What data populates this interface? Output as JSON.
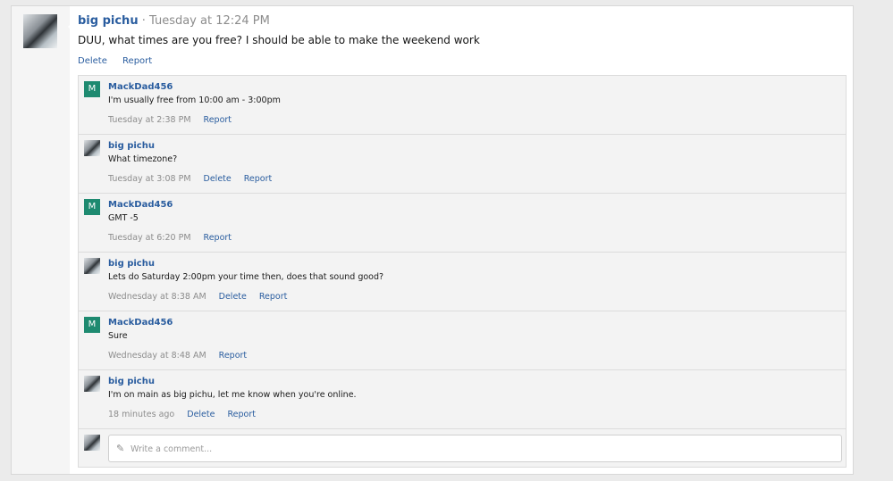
{
  "post": {
    "username": "big pichu",
    "separator": " · ",
    "timestamp": "Tuesday at 12:24 PM",
    "text": "DUU, what times are you free? I should be able to make the weekend work",
    "delete_label": "Delete",
    "report_label": "Report"
  },
  "replies": [
    {
      "avatar_letter": "M",
      "username": "MackDad456",
      "text": "I'm usually free from 10:00 am - 3:00pm",
      "time": "Tuesday at 2:38 PM",
      "report_label": "Report"
    },
    {
      "username": "big pichu",
      "text": "What timezone?",
      "time": "Tuesday at 3:08 PM",
      "delete_label": "Delete",
      "report_label": "Report"
    },
    {
      "avatar_letter": "M",
      "username": "MackDad456",
      "text": "GMT -5",
      "time": "Tuesday at 6:20 PM",
      "report_label": "Report"
    },
    {
      "username": "big pichu",
      "text": "Lets do Saturday 2:00pm your time then, does that sound good?",
      "time": "Wednesday at 8:38 AM",
      "delete_label": "Delete",
      "report_label": "Report"
    },
    {
      "avatar_letter": "M",
      "username": "MackDad456",
      "text": "Sure",
      "time": "Wednesday at 8:48 AM",
      "report_label": "Report"
    },
    {
      "username": "big pichu",
      "text": "I'm on main as big pichu, let me know when you're online.",
      "time": "18 minutes ago",
      "delete_label": "Delete",
      "report_label": "Report"
    }
  ],
  "comment": {
    "placeholder": "Write a comment...",
    "icon": "pencil-icon"
  },
  "colors": {
    "link": "#2a5d9f",
    "avatar_m_bg": "#1e8a70",
    "muted": "#8c8c8c"
  }
}
